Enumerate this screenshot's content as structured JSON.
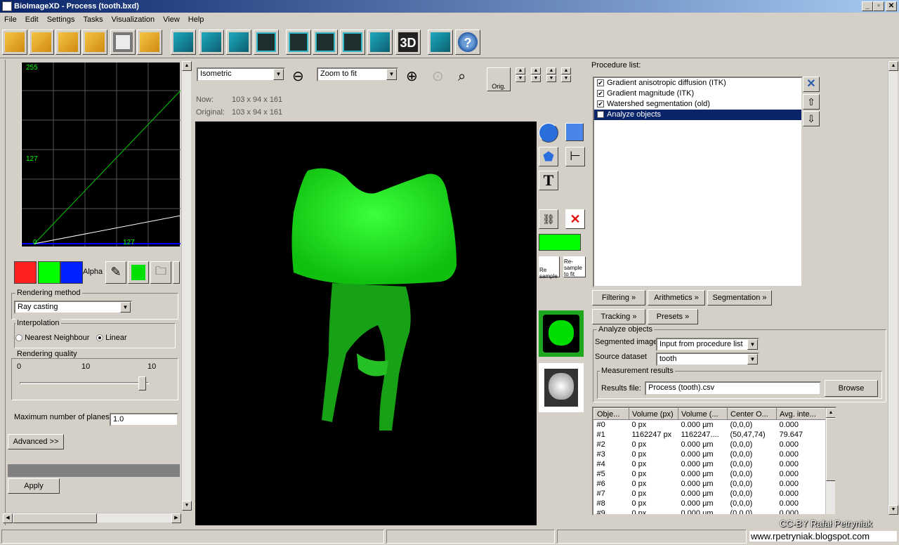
{
  "window": {
    "title": "BioImageXD - Process (tooth.bxd)",
    "min": "_",
    "max": "▫",
    "close": "✕"
  },
  "menu": [
    "File",
    "Edit",
    "Settings",
    "Tasks",
    "Visualization",
    "View",
    "Help"
  ],
  "toolbar": [
    "open-file",
    "open-folder",
    "tools",
    "tools-2",
    "snapshot",
    "branch",
    "teal-cube",
    "teal-cube-2",
    "light-adjust",
    "slice-tool",
    "dark-outline",
    "gallery",
    "section",
    "render",
    "3D",
    "animator",
    "help"
  ],
  "toolbar_labels": {
    "3d": "3D",
    "help": "?"
  },
  "histogram": {
    "y_max": "255",
    "y_mid": "127",
    "x_min": "0",
    "x_mid": "127"
  },
  "colors": {
    "red": "#ff2020",
    "green": "#00ff00",
    "blue": "#0020ff",
    "swatch": "#00e000"
  },
  "left": {
    "alpha_label": "Alpha",
    "rendering_method_title": "Rendering method",
    "rendering_method_value": "Ray casting",
    "interpolation_title": "Interpolation",
    "interp_nearest": "Nearest Neighbour",
    "interp_linear": "Linear",
    "quality_title": "Rendering quality",
    "quality_min": "0",
    "quality_mid": "10",
    "quality_max": "10",
    "quality_fraction": 0.95,
    "max_planes_label": "Maximum number of planes:",
    "max_planes_value": "1.0",
    "advanced_label": "Advanced >>",
    "apply_label": "Apply"
  },
  "center": {
    "projection": "Isometric",
    "zoom": "Zoom to fit",
    "now_label": "Now:",
    "now_value": "103 x 94 x 161",
    "orig_label": "Original:",
    "orig_value": "103 x 94 x 161",
    "orig_btn": "Orig.",
    "resample_label": "Re sample",
    "resample_fit_label": "Re-sample to fit"
  },
  "right": {
    "procedure_title": "Procedure list:",
    "procedures": [
      {
        "label": "Gradient anisotropic diffusion (ITK)",
        "checked": "✔"
      },
      {
        "label": "Gradient magnitude (ITK)",
        "checked": "✔"
      },
      {
        "label": "Watershed segmentation (old)",
        "checked": "✔"
      },
      {
        "label": "Analyze objects",
        "checked": "✔"
      }
    ],
    "filter_buttons": [
      "Filtering »",
      "Arithmetics »",
      "Segmentation »",
      "Tracking »",
      "Presets »"
    ],
    "analyze_title": "Analyze objects",
    "segmented_label": "Segmented image",
    "segmented_value": "Input from procedure list",
    "source_label": "Source dataset",
    "source_value": "tooth",
    "measurement_title": "Measurement results",
    "results_label": "Results file:",
    "results_value": "Process (tooth).csv",
    "browse_label": "Browse",
    "columns": [
      "Obje...",
      "Volume (px)",
      "Volume (...",
      "Center O...",
      "Avg. inte..."
    ],
    "rows": [
      [
        "#0",
        "0 px",
        "0.000 µm",
        "(0,0,0)",
        "0.000"
      ],
      [
        "#1",
        "1162247 px",
        "1162247....",
        "(50,47,74)",
        "79.647"
      ],
      [
        "#2",
        "0 px",
        "0.000 µm",
        "(0,0,0)",
        "0.000"
      ],
      [
        "#3",
        "0 px",
        "0.000 µm",
        "(0,0,0)",
        "0.000"
      ],
      [
        "#4",
        "0 px",
        "0.000 µm",
        "(0,0,0)",
        "0.000"
      ],
      [
        "#5",
        "0 px",
        "0.000 µm",
        "(0,0,0)",
        "0.000"
      ],
      [
        "#6",
        "0 px",
        "0.000 µm",
        "(0,0,0)",
        "0.000"
      ],
      [
        "#7",
        "0 px",
        "0.000 µm",
        "(0,0,0)",
        "0.000"
      ],
      [
        "#8",
        "0 px",
        "0.000 µm",
        "(0,0,0)",
        "0.000"
      ],
      [
        "#9",
        "0 px",
        "0.000 µm",
        "(0,0,0)",
        "0.000"
      ]
    ]
  },
  "watermark": {
    "line1": "CC-BY Rafał Petryniak",
    "line2": "www.rpetryniak.blogspot.com"
  }
}
